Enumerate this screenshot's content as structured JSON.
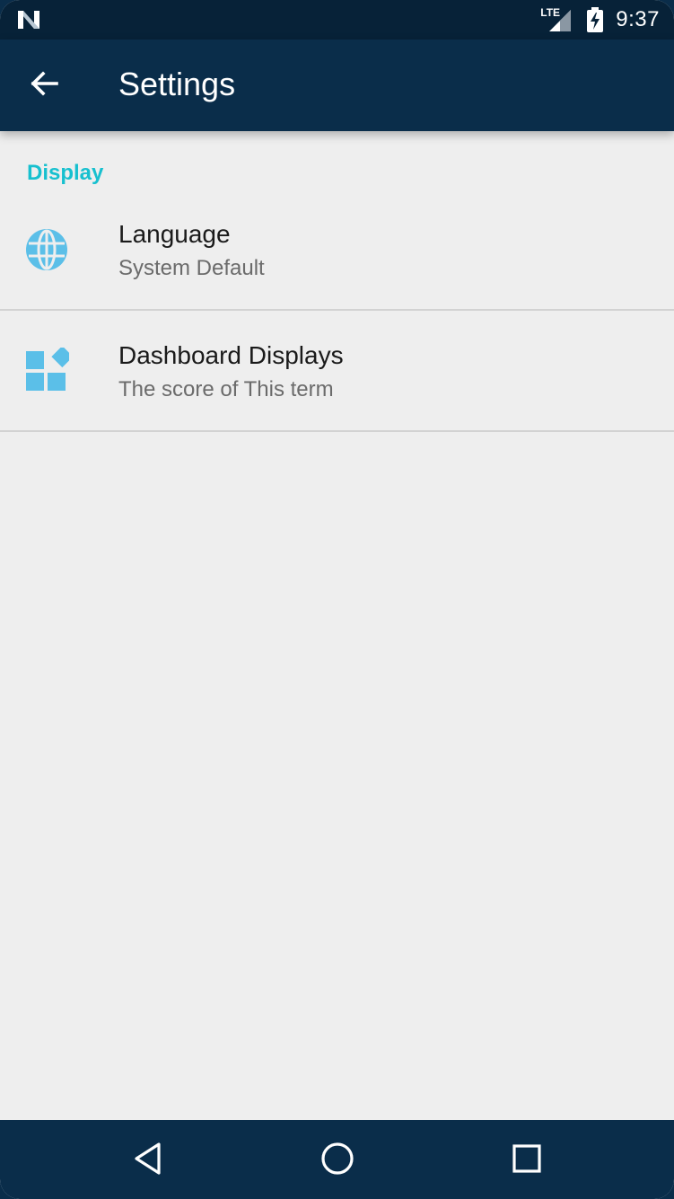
{
  "status_bar": {
    "time": "9:37",
    "network": "LTE",
    "notification_icon": "n-logo-icon",
    "signal_icon": "signal-icon",
    "battery_icon": "battery-charging-icon"
  },
  "app_bar": {
    "title": "Settings",
    "back_icon": "arrow-back-icon"
  },
  "sections": [
    {
      "header": "Display",
      "items": [
        {
          "title": "Language",
          "summary": "System Default",
          "icon": "globe-icon"
        },
        {
          "title": "Dashboard Displays",
          "summary": "The score of This term",
          "icon": "dashboard-widgets-icon"
        }
      ]
    }
  ],
  "nav_bar": {
    "back_icon": "triangle-back-icon",
    "home_icon": "circle-home-icon",
    "recents_icon": "square-recents-icon"
  },
  "colors": {
    "primary_dark": "#072238",
    "primary": "#0a2d4a",
    "accent": "#17c0cf",
    "icon_blue": "#5bbfe8",
    "background": "#eeeeee",
    "divider": "#d2d2d2"
  }
}
